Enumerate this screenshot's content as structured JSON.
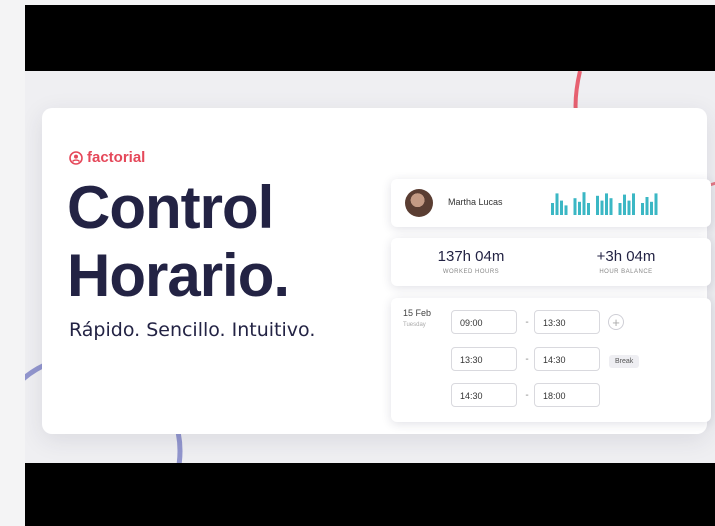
{
  "brand": {
    "name": "factorial",
    "accent": "#e5485a",
    "text_color": "#232344"
  },
  "headline": {
    "line1": "Control",
    "line2": "Horario."
  },
  "tagline": "Rápido. Sencillo. Intuitivo.",
  "user": {
    "name": "Martha Lucas",
    "activity": [
      0.5,
      0.9,
      0.6,
      0.4,
      0.7,
      0.55,
      0.95,
      0.5,
      0.8,
      0.6,
      0.9,
      0.7,
      0.5,
      0.85,
      0.6,
      0.9,
      0.5,
      0.75,
      0.55,
      0.9
    ]
  },
  "stats": [
    {
      "value": "137h 04m",
      "label": "WORKED HOURS"
    },
    {
      "value": "+3h 04m",
      "label": "HOUR BALANCE"
    }
  ],
  "schedule": {
    "date": "15 Feb",
    "day": "Tuesday",
    "entries": [
      {
        "start": "09:00",
        "end": "13:30",
        "tag": ""
      },
      {
        "start": "13:30",
        "end": "14:30",
        "tag": "Break"
      },
      {
        "start": "14:30",
        "end": "18:00",
        "tag": ""
      }
    ],
    "add_symbol": "+",
    "separator": "-"
  },
  "colors": {
    "bars": "#3bb7c4",
    "ring_red": "#e5485a",
    "ring_blue": "#7b7fc4"
  }
}
